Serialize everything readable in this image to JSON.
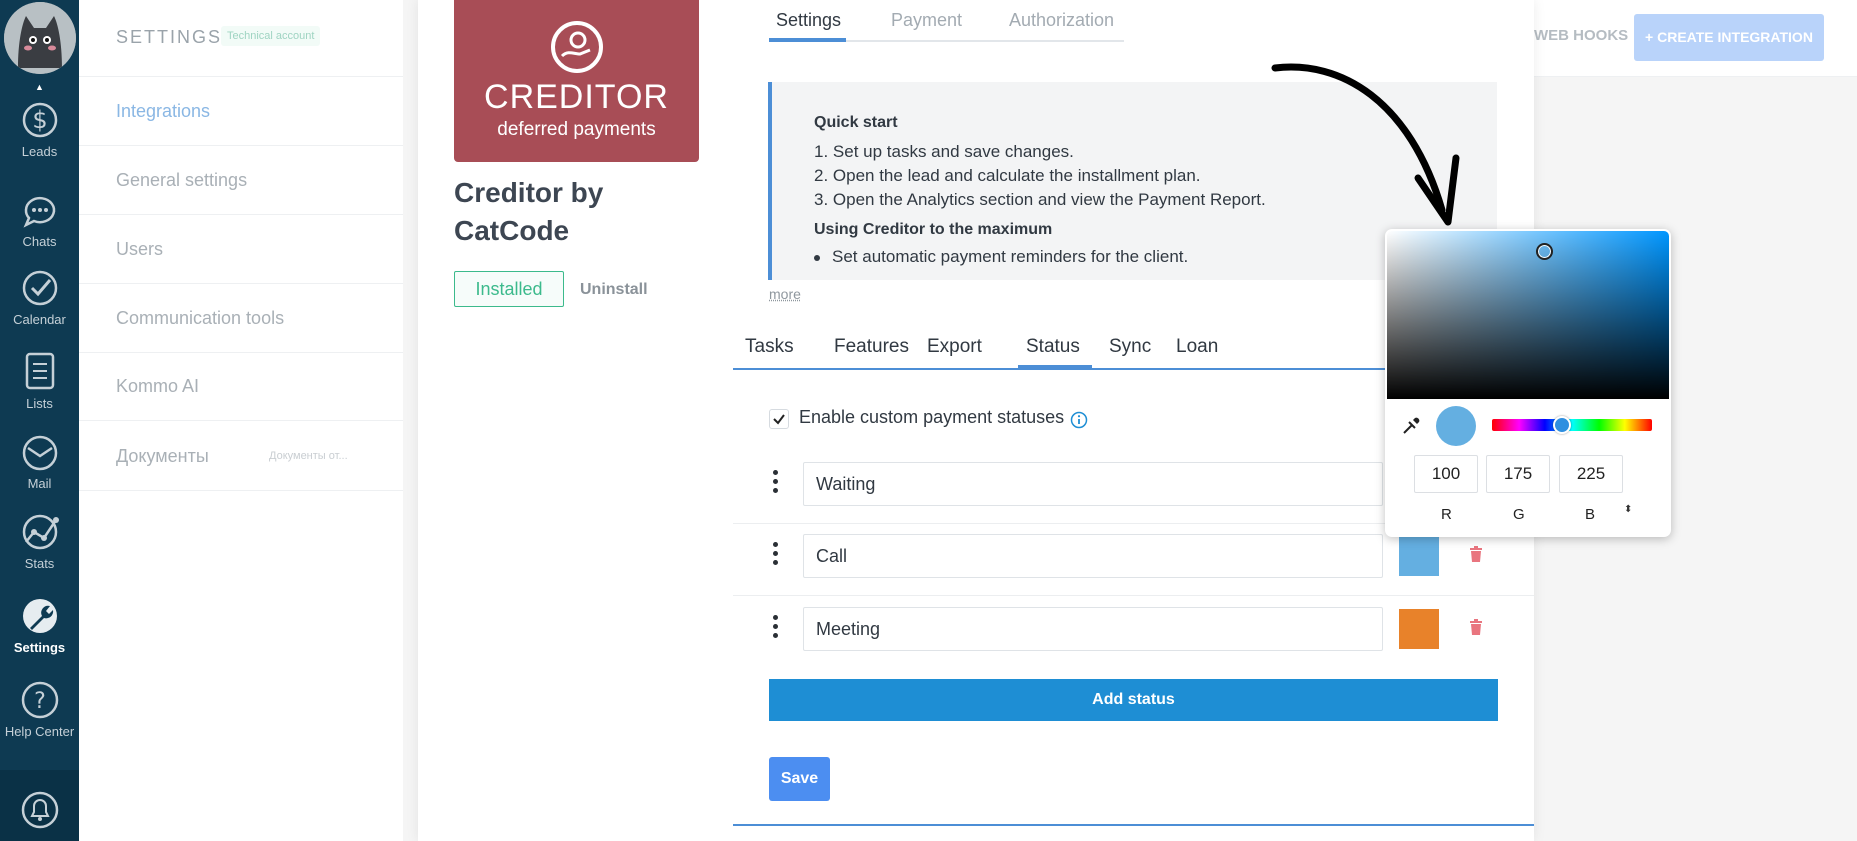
{
  "nav": {
    "items": [
      {
        "label": "Leads"
      },
      {
        "label": "Chats"
      },
      {
        "label": "Calendar"
      },
      {
        "label": "Lists"
      },
      {
        "label": "Mail"
      },
      {
        "label": "Stats"
      },
      {
        "label": "Settings"
      },
      {
        "label": "Help Center"
      }
    ]
  },
  "settings_sidebar": {
    "title": "SETTINGS",
    "badge": "Technical account",
    "items": [
      {
        "label": "Integrations"
      },
      {
        "label": "General settings"
      },
      {
        "label": "Users"
      },
      {
        "label": "Communication tools"
      },
      {
        "label": "Kommo AI"
      },
      {
        "label": "Документы",
        "sub": "Документы от..."
      }
    ]
  },
  "topbar": {
    "webhooks_label": "WEB HOOKS",
    "create_label": "+ CREATE INTEGRATION"
  },
  "integration": {
    "logo_name": "CREDITOR",
    "logo_sub": "deferred payments",
    "title": "Creditor by CatCode",
    "installed_label": "Installed",
    "uninstall_label": "Uninstall"
  },
  "top_tabs": [
    {
      "label": "Settings"
    },
    {
      "label": "Payment"
    },
    {
      "label": "Authorization"
    }
  ],
  "quick_start": {
    "heading": "Quick start",
    "steps": [
      "1. Set up tasks and save changes.",
      "2. Open the lead and calculate the installment plan.",
      "3. Open the Analytics section and view the Payment Report."
    ],
    "heading2": "Using Creditor to the maximum",
    "bullets": [
      "Set automatic payment reminders for the client."
    ],
    "more_label": "more"
  },
  "sub_tabs": [
    {
      "label": "Tasks"
    },
    {
      "label": "Features"
    },
    {
      "label": "Export"
    },
    {
      "label": "Status"
    },
    {
      "label": "Sync"
    },
    {
      "label": "Loan"
    }
  ],
  "status_section": {
    "enable_label": "Enable custom payment statuses",
    "enabled": true,
    "statuses": [
      {
        "name": "Waiting",
        "color": "#3cba8c"
      },
      {
        "name": "Call",
        "color": "#64afe1"
      },
      {
        "name": "Meeting",
        "color": "#e8822a"
      }
    ],
    "add_label": "Add status",
    "save_label": "Save"
  },
  "color_picker": {
    "r": "100",
    "g": "175",
    "b": "225",
    "r_label": "R",
    "g_label": "G",
    "b_label": "B",
    "preview_color": "#64afe1"
  },
  "colors": {
    "nav_bg": "#0e3a52",
    "accent_blue": "#4c8ed6",
    "logo_bg": "#a84d56",
    "add_status_bg": "#1e8ed4",
    "save_bg": "#4c8ef1"
  }
}
